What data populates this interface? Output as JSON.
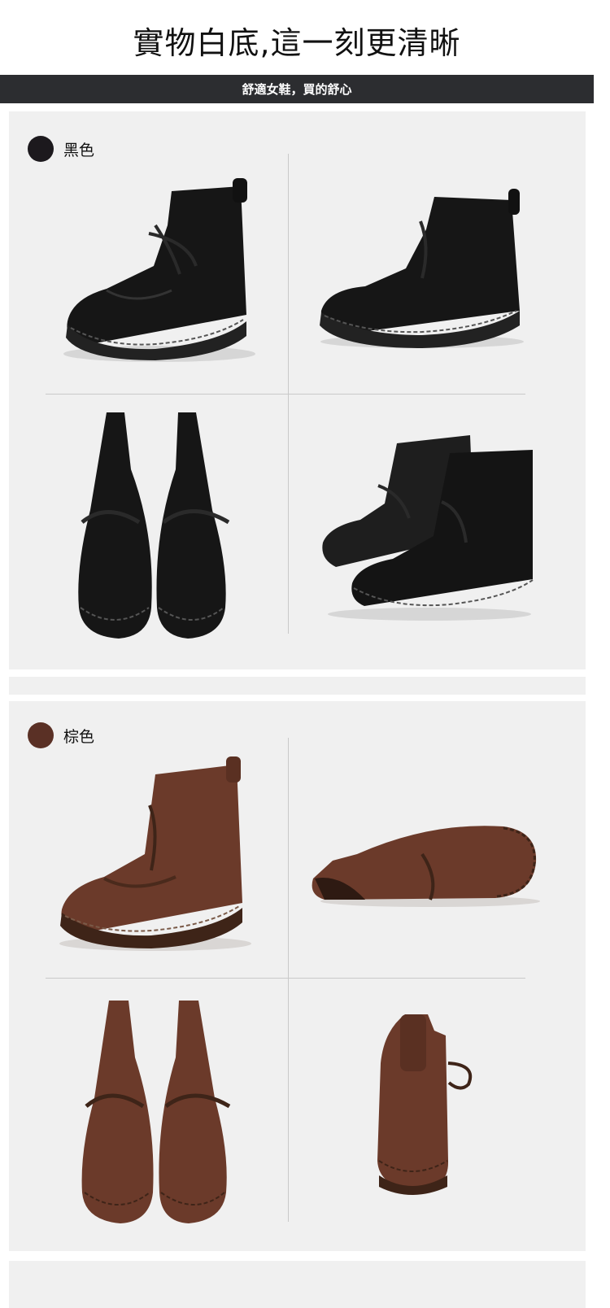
{
  "header": {
    "title": "實物白底,這一刻更清晰",
    "banner": "舒適女鞋，買的舒心"
  },
  "colors": {
    "banner_bg": "#2c2d30",
    "panel_bg": "#f0f0f0",
    "black_swatch": "#1c191d",
    "brown_swatch": "#5a3025"
  },
  "variants": [
    {
      "label": "黑色",
      "swatch_color": "#1c191d",
      "images": [
        "black-boot-side-left",
        "black-boot-side-right",
        "black-boots-pair-top",
        "black-boots-pair-angle"
      ]
    },
    {
      "label": "棕色",
      "swatch_color": "#5a3025",
      "images": [
        "brown-boot-side",
        "brown-boot-lying",
        "brown-boots-pair-top",
        "brown-boot-back"
      ]
    }
  ]
}
